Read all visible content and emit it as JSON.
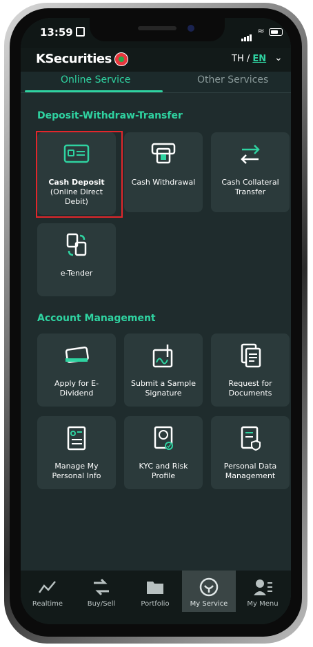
{
  "status_bar": {
    "time": "13:59"
  },
  "header": {
    "brand": "KSecurities",
    "lang_th": "TH",
    "lang_sep": " / ",
    "lang_en": "EN"
  },
  "tabs": [
    {
      "label": "Online Service",
      "active": true
    },
    {
      "label": "Other Services",
      "active": false
    }
  ],
  "sections": {
    "deposit": {
      "title": "Deposit-Withdraw-Transfer",
      "cards": [
        {
          "line1": "Cash Deposit",
          "line2": "(Online Direct",
          "line3": "Debit)",
          "icon": "card-icon"
        },
        {
          "line1": "Cash Withdrawal",
          "icon": "atm-icon"
        },
        {
          "line1": "Cash Collateral",
          "line2": "Transfer",
          "icon": "transfer-icon"
        },
        {
          "line1": "e-Tender",
          "icon": "documents-swap-icon"
        }
      ]
    },
    "account": {
      "title": "Account Management",
      "cards": [
        {
          "line1": "Apply for E-",
          "line2": "Dividend",
          "icon": "dividend-card-icon"
        },
        {
          "line1": "Submit a Sample",
          "line2": "Signature",
          "icon": "signature-icon"
        },
        {
          "line1": "Request for",
          "line2": "Documents",
          "icon": "documents-icon"
        },
        {
          "line1": "Manage My",
          "line2": "Personal Info",
          "icon": "personal-info-icon"
        },
        {
          "line1": "KYC and Risk",
          "line2": "Profile",
          "icon": "kyc-icon"
        },
        {
          "line1": "Personal Data",
          "line2": "Management",
          "icon": "data-shield-icon"
        }
      ]
    }
  },
  "bottom_nav": [
    {
      "label": "Realtime",
      "icon": "chart-line-icon"
    },
    {
      "label": "Buy/Sell",
      "icon": "swap-arrows-icon"
    },
    {
      "label": "Portfolio",
      "icon": "folder-icon"
    },
    {
      "label": "My Service",
      "icon": "service-badge-icon",
      "active": true
    },
    {
      "label": "My Menu",
      "icon": "user-menu-icon"
    }
  ],
  "colors": {
    "accent": "#2fd3a1",
    "background": "#1f2c2d",
    "card": "#2b3a3b",
    "highlight": "#e3262b"
  }
}
